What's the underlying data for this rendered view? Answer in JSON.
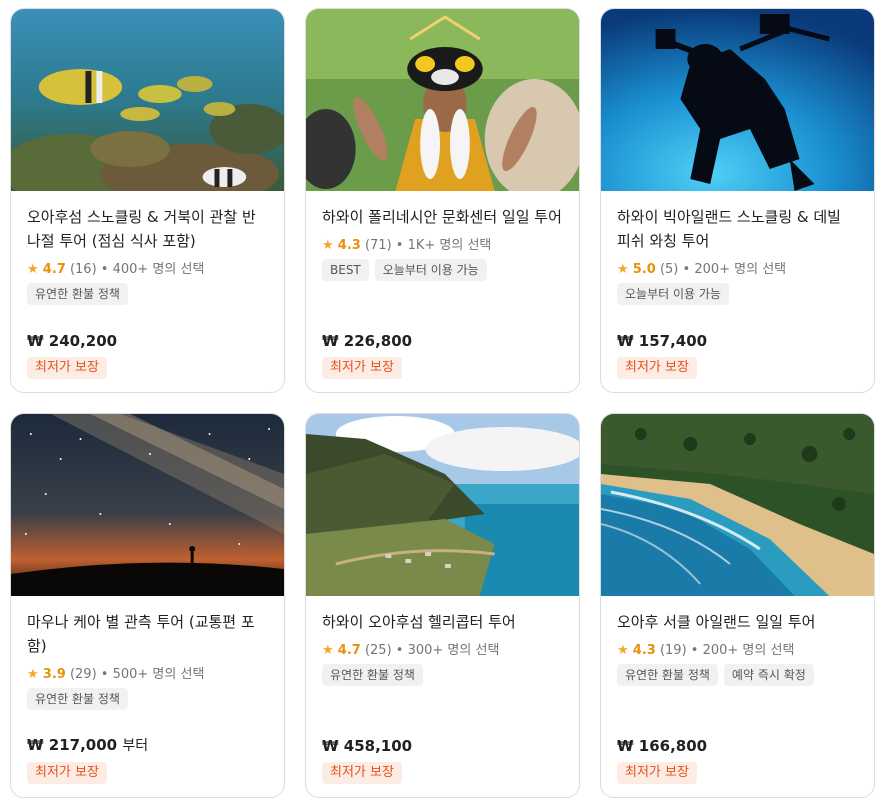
{
  "cards": [
    {
      "title": "오아후섬 스노클링 & 거북이 관찰 반나절 투어 (점심 식사 포함)",
      "rating": "4.7",
      "reviews": "(16)",
      "participants": "400+ 명의 선택",
      "tags": [
        "유연한 환불 정책"
      ],
      "price": "₩ 240,200",
      "price_suffix": "",
      "guarantee": "최저가 보장",
      "image": "underwater-fish-reef"
    },
    {
      "title": "하와이 폴리네시안 문화센터 일일 투어",
      "rating": "4.3",
      "reviews": "(71)",
      "participants": "1K+ 명의 선택",
      "tags": [
        "BEST",
        "오늘부터 이용 가능"
      ],
      "price": "₩ 226,800",
      "price_suffix": "",
      "guarantee": "최저가 보장",
      "image": "polynesian-dancer"
    },
    {
      "title": "하와이 빅아일랜드 스노클링 & 데빌 피쉬 와칭 투어",
      "rating": "5.0",
      "reviews": "(5)",
      "participants": "200+ 명의 선택",
      "tags": [
        "오늘부터 이용 가능"
      ],
      "price": "₩ 157,400",
      "price_suffix": "",
      "guarantee": "최저가 보장",
      "image": "scuba-diver-silhouette"
    },
    {
      "title": "마우나 케아 별 관측 투어 (교통편 포함)",
      "rating": "3.9",
      "reviews": "(29)",
      "participants": "500+ 명의 선택",
      "tags": [
        "유연한 환불 정책"
      ],
      "price": "₩ 217,000",
      "price_suffix": "부터",
      "guarantee": "최저가 보장",
      "image": "milky-way-night-sky"
    },
    {
      "title": "하와이 오아후섬 헬리콥터 투어",
      "rating": "4.7",
      "reviews": "(25)",
      "participants": "300+ 명의 선택",
      "tags": [
        "유연한 환불 정책"
      ],
      "price": "₩ 458,100",
      "price_suffix": "",
      "guarantee": "최저가 보장",
      "image": "aerial-coast-mountain"
    },
    {
      "title": "오아후 서클 아일랜드 일일 투어",
      "rating": "4.3",
      "reviews": "(19)",
      "participants": "200+ 명의 선택",
      "tags": [
        "유연한 환불 정책",
        "예약 즉시 확정"
      ],
      "price": "₩ 166,800",
      "price_suffix": "",
      "guarantee": "최저가 보장",
      "image": "aerial-beach"
    }
  ],
  "colors": {
    "star": "#f5a623",
    "rating": "#e8920c",
    "guarantee_text": "#e8501b",
    "guarantee_bg": "#fdece4",
    "tag_bg": "#f1f1f1"
  }
}
